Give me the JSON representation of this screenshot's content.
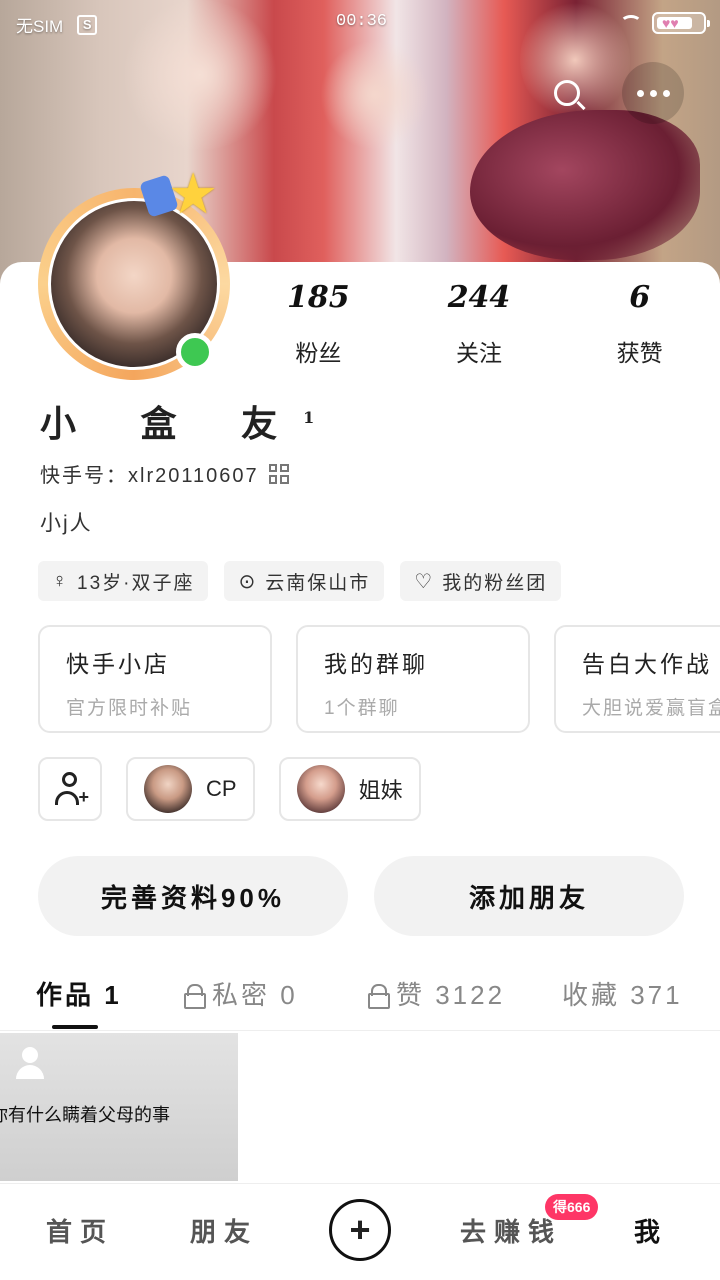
{
  "status_bar": {
    "sim": "无SIM",
    "s_badge": "S",
    "time": "00:36"
  },
  "profile": {
    "nickname": "小 盒 友",
    "nickname_sup": "1",
    "kuaishou_id": "快手号：xlr20110607",
    "bio": "小j人",
    "stats": [
      {
        "value": "185",
        "label": "粉丝"
      },
      {
        "value": "244",
        "label": "关注"
      },
      {
        "value": "6",
        "label": "获赞"
      }
    ]
  },
  "tags": [
    {
      "icon": "gender-female-icon",
      "label": "13岁·双子座"
    },
    {
      "icon": "location-pin-icon",
      "label": "云南保山市"
    },
    {
      "icon": "heart-icon",
      "label": "我的粉丝团"
    }
  ],
  "feature_cards": [
    {
      "title": "快手小店",
      "subtitle": "官方限时补贴"
    },
    {
      "title": "我的群聊",
      "subtitle": "1个群聊"
    },
    {
      "title": "告白大作战",
      "subtitle": "大胆说爱赢盲盒"
    }
  ],
  "relations": [
    {
      "label": "CP"
    },
    {
      "label": "姐妹"
    }
  ],
  "actions": {
    "complete_profile": "完善资料90%",
    "add_friend": "添加朋友"
  },
  "tabs": [
    {
      "label": "作品 1",
      "locked": false
    },
    {
      "label": "私密 0",
      "locked": true
    },
    {
      "label": "赞 3122",
      "locked": true
    },
    {
      "label": "收藏 371",
      "locked": false
    }
  ],
  "posts": [
    {
      "caption": "你有什么瞒着父母的事"
    }
  ],
  "bottom_nav": {
    "home": "首页",
    "friends": "朋友",
    "earn": "去赚钱",
    "earn_badge": "得666",
    "me": "我"
  },
  "colors": {
    "online": "#3ec852",
    "badge": "#fe3666",
    "ring": "#f7b56d"
  }
}
